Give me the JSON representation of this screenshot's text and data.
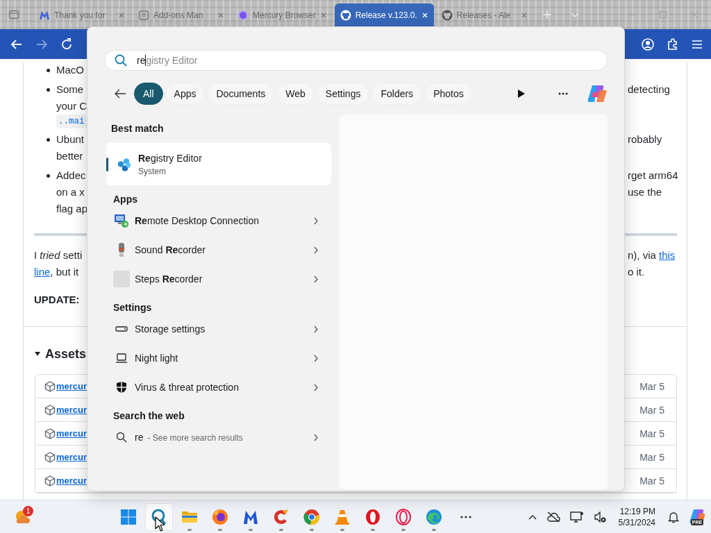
{
  "browser": {
    "tabs": [
      {
        "kind": "m-logo",
        "title": "Thank you for",
        "selected": false
      },
      {
        "kind": "page",
        "title": "Add-ons Man",
        "selected": false
      },
      {
        "kind": "dot",
        "title": "Mercury Browser",
        "selected": false
      },
      {
        "kind": "round-logo",
        "title": "Release v.123.0.",
        "selected": true
      },
      {
        "kind": "round-logo",
        "title": "Releases - Ale",
        "selected": false
      }
    ],
    "nav": [
      {
        "kind": "back",
        "disabled": false
      },
      {
        "kind": "forward",
        "disabled": true
      },
      {
        "kind": "reload",
        "disabled": false
      }
    ]
  },
  "release": {
    "lines": [
      {
        "kind": "bullet",
        "left": "MacO"
      },
      {
        "kind": "bullet",
        "left": "Some",
        "right": "detecting"
      },
      {
        "kind": "cont",
        "left": "your C"
      },
      {
        "kind": "code",
        "left": "..mai"
      },
      {
        "kind": "bullet",
        "left": "Ubunt",
        "right": "robably"
      },
      {
        "kind": "cont",
        "left": "better"
      },
      {
        "kind": "bullet",
        "left": "Addec",
        "right": "rget arm64"
      },
      {
        "kind": "cont",
        "left": "on a x",
        "right": "use the"
      },
      {
        "kind": "cont",
        "left": "flag ap"
      },
      {
        "kind": "rule"
      },
      {
        "kind": "para",
        "left": "I *tried* setti",
        "right": "n), via",
        "right_link": "this"
      },
      {
        "kind": "cont-para",
        "left_link": "line",
        "left": ", but it",
        "right": "o it."
      },
      {
        "kind": "para",
        "left": "**UPDATE:**"
      }
    ],
    "assets_heading": "Assets",
    "assets": [
      {
        "name": "mercur",
        "date": "Mar 5"
      },
      {
        "name": "mercur",
        "date": "Mar 5"
      },
      {
        "name": "mercur",
        "date": "Mar 5"
      },
      {
        "name": "mercur",
        "date": "Mar 5"
      },
      {
        "name": "mercur",
        "date": "Mar 5"
      }
    ]
  },
  "search": {
    "query": "re",
    "completion": "gistry Editor",
    "filters": [
      {
        "label": "All",
        "selected": true
      },
      {
        "label": "Apps",
        "selected": false
      },
      {
        "label": "Documents",
        "selected": false
      },
      {
        "label": "Web",
        "selected": false
      },
      {
        "label": "Settings",
        "selected": false
      },
      {
        "label": "Folders",
        "selected": false
      },
      {
        "label": "Photos",
        "selected": false
      }
    ],
    "best_match": {
      "heading": "Best match",
      "kind": "registry",
      "title": "**Re**gistry Editor",
      "subtitle": "System",
      "selected": true
    },
    "sections": [
      {
        "heading": "Apps",
        "items": [
          {
            "kind": "remote-desktop",
            "title": "**Re**mote Desktop Connection",
            "selected": false
          },
          {
            "kind": "microphone",
            "title": "Sound **Re**corder",
            "selected": false
          },
          {
            "kind": "blank",
            "title": "Steps **Re**corder",
            "selected": false
          }
        ]
      },
      {
        "heading": "Settings",
        "items": [
          {
            "kind": "storage",
            "title": "Storage settings",
            "selected": false
          },
          {
            "kind": "laptop",
            "title": "Night light",
            "selected": false
          },
          {
            "kind": "shield",
            "title": "Virus & threat protection",
            "selected": false
          }
        ]
      },
      {
        "heading": "Search the web",
        "items": [
          {
            "kind": "web",
            "title": "re",
            "hint": "- See more search results",
            "selected": false
          }
        ]
      }
    ]
  },
  "taskbar": {
    "weather_badge": "1",
    "apps": [
      {
        "kind": "start",
        "selected": false,
        "running": false
      },
      {
        "kind": "search",
        "selected": true,
        "running": false
      },
      {
        "kind": "folder",
        "selected": false,
        "running": true
      },
      {
        "kind": "firefox",
        "selected": false,
        "running": true
      },
      {
        "kind": "m-logo",
        "selected": false,
        "running": true
      },
      {
        "kind": "c-logo",
        "selected": false,
        "running": true
      },
      {
        "kind": "chrome",
        "selected": false,
        "running": true
      },
      {
        "kind": "cone",
        "selected": false,
        "running": true
      },
      {
        "kind": "o-logo",
        "selected": false,
        "running": true
      },
      {
        "kind": "ring",
        "selected": false,
        "running": true
      },
      {
        "kind": "edge",
        "selected": false,
        "running": true
      }
    ],
    "time": "12:19 PM",
    "date": "5/31/2024",
    "app_badge": "PRE"
  }
}
